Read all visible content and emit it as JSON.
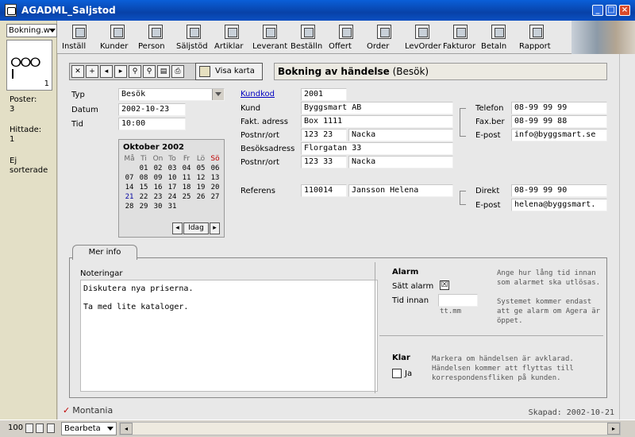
{
  "window": {
    "title": "AGADML_Saljstod"
  },
  "left_panel": {
    "layout_select": "Bokning.w",
    "page_number": "1",
    "poster_label": "Poster:",
    "poster_value": "3",
    "hittade_label": "Hittade:",
    "hittade_value": "1",
    "sort_status": "Ej sorterade"
  },
  "toolbar": {
    "items": [
      {
        "label": "Inställ",
        "icon": "settings-icon"
      },
      {
        "label": "Kunder",
        "icon": "customers-icon"
      },
      {
        "label": "Person",
        "icon": "person-icon"
      },
      {
        "label": "Säljstöd",
        "icon": "sales-icon"
      },
      {
        "label": "Artiklar",
        "icon": "articles-icon"
      },
      {
        "label": "Leverant",
        "icon": "supplier-icon"
      },
      {
        "label": "Beställn",
        "icon": "order-icon"
      },
      {
        "label": "Offert",
        "icon": "quote-icon"
      },
      {
        "label": "Order",
        "icon": "order-icon"
      },
      {
        "label": "LevOrder",
        "icon": "supplier-order-icon"
      },
      {
        "label": "Fakturor",
        "icon": "invoice-icon"
      },
      {
        "label": "Betaln",
        "icon": "payment-icon"
      },
      {
        "label": "Rapport",
        "icon": "printer-icon"
      }
    ]
  },
  "record_nav": {
    "show_map_label": "Visa karta",
    "header_title": "Bokning av händelse",
    "header_type": "(Besök)"
  },
  "form": {
    "typ_label": "Typ",
    "typ_value": "Besök",
    "datum_label": "Datum",
    "datum_value": "2002-10-23",
    "tid_label": "Tid",
    "tid_value": "10:00",
    "kundkod_label": "Kundkod",
    "kundkod_value": "2001",
    "kund_label": "Kund",
    "kund_value": "Byggsmart AB",
    "fakt_label": "Fakt. adress",
    "fakt_value": "Box 1111",
    "postnr1_label": "Postnr/ort",
    "postnr1_value": "123 23",
    "ort1_value": "Nacka",
    "besok_label": "Besöksadress",
    "besok_value": "Florgatan 33",
    "postnr2_label": "Postnr/ort",
    "postnr2_value": "123 33",
    "ort2_value": "Nacka",
    "telefon_label": "Telefon",
    "telefon_value": "08-99 99 99",
    "fax_label": "Fax.ber",
    "fax_value": "08-99 99 88",
    "epost1_label": "E-post",
    "epost1_value": "info@byggsmart.se",
    "referens_label": "Referens",
    "referens_code": "110014",
    "referens_name": "Jansson Helena",
    "direkt_label": "Direkt",
    "direkt_value": "08-99 99 90",
    "epost2_label": "E-post",
    "epost2_value": "helena@byggsmart."
  },
  "calendar": {
    "month_label": "Oktober 2002",
    "day_headers": [
      "Må",
      "Ti",
      "On",
      "To",
      "Fr",
      "Lö",
      "Sö"
    ],
    "weeks": [
      [
        "",
        "01",
        "02",
        "03",
        "04",
        "05",
        "06"
      ],
      [
        "07",
        "08",
        "09",
        "10",
        "11",
        "12",
        "13"
      ],
      [
        "14",
        "15",
        "16",
        "17",
        "18",
        "19",
        "20"
      ],
      [
        "21",
        "22",
        "23",
        "24",
        "25",
        "26",
        "27"
      ],
      [
        "28",
        "29",
        "30",
        "31",
        "",
        "",
        ""
      ]
    ],
    "today_label": "Idag"
  },
  "tab": {
    "label": "Mer info",
    "notes_label": "Noteringar",
    "notes_line1": "Diskutera nya priserna.",
    "notes_line2": "Ta med lite kataloger.",
    "alarm_title": "Alarm",
    "alarm_set_label": "Sätt alarm",
    "alarm_set_checked": "☒",
    "tid_innan_label": "Tid innan",
    "tid_innan_value": "",
    "tid_format": "tt.mm",
    "help1_line1": "Ange hur lång tid innan",
    "help1_line2": "som alarmet ska utlösas.",
    "help2_line1": "Systemet kommer endast",
    "help2_line2": "att ge alarm om Agera är",
    "help2_line3": "öppet.",
    "klar_title": "Klar",
    "klar_ja_label": "Ja",
    "help3_line1": "Markera om händelsen är avklarad.",
    "help3_line2": "Händelsen kommer att flyttas till",
    "help3_line3": "korrespondensfliken på kunden."
  },
  "footer": {
    "brand": "Montania",
    "created": "Skapad: 2002-10-21"
  },
  "statusbar": {
    "zoom": "100",
    "mode": "Bearbeta"
  }
}
